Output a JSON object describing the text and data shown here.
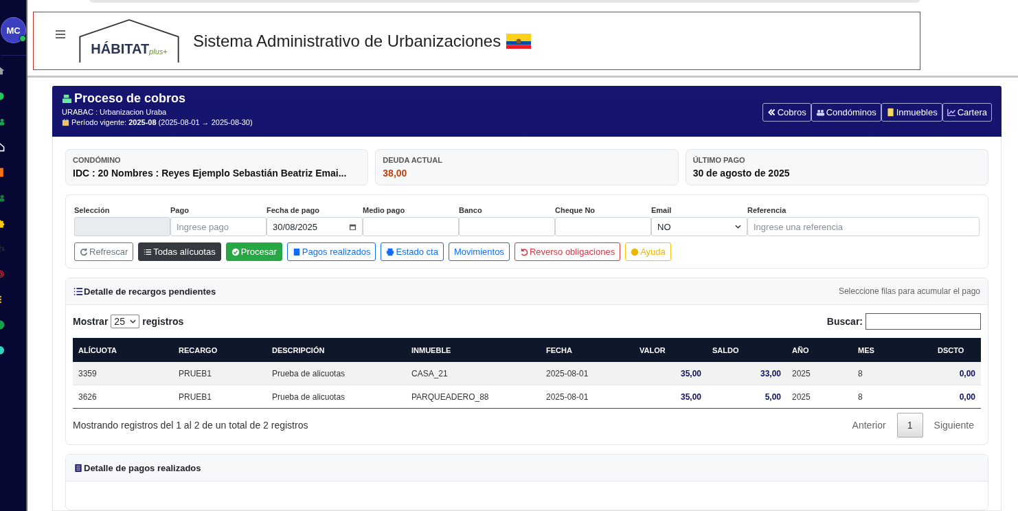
{
  "user": {
    "initials": "MC",
    "online": true
  },
  "header": {
    "logo_text": "HÁBITAT",
    "logo_suffix": "plus+",
    "title": "Sistema Administrativo de Urbanizaciones"
  },
  "panel": {
    "title": "Proceso de cobros",
    "subtitle": "URABAC : Urbanizacion Uraba",
    "period_label": "Período vigente:",
    "period_code": "2025-08",
    "period_range": "(2025-08-01 → 2025-08-30)",
    "nav_buttons": [
      "Cobros",
      "Condóminos",
      "Inmuebles",
      "Cartera"
    ]
  },
  "summary": [
    {
      "label": "CONDÓMINO",
      "value": "IDC : 20 Nombres : Reyes Ejemplo Sebastián Beatriz Emai...",
      "kind": "plain"
    },
    {
      "label": "DEUDA ACTUAL",
      "value": "38,00",
      "kind": "debt"
    },
    {
      "label": "ÚLTIMO PAGO",
      "value": "30 de agosto de 2025",
      "kind": "plain"
    }
  ],
  "form": {
    "fields": [
      {
        "label": "Selección",
        "kind": "readonly"
      },
      {
        "label": "Pago",
        "kind": "text",
        "placeholder": "Ingrese pago"
      },
      {
        "label": "Fecha de pago",
        "kind": "date",
        "value": "30/08/2025"
      },
      {
        "label": "Medio pago",
        "kind": "text"
      },
      {
        "label": "Banco",
        "kind": "text"
      },
      {
        "label": "Cheque No",
        "kind": "text"
      },
      {
        "label": "Email",
        "kind": "select",
        "value": "NO"
      },
      {
        "label": "Referencia",
        "kind": "wide",
        "placeholder": "Ingrese una referencia"
      }
    ],
    "buttons": [
      {
        "label": "Refrescar",
        "kind": "secondary"
      },
      {
        "label": "Todas alícuotas",
        "kind": "dark"
      },
      {
        "label": "Procesar",
        "kind": "success"
      },
      {
        "label": "Pagos realizados",
        "kind": "primary"
      },
      {
        "label": "Estado cta",
        "kind": "primary"
      },
      {
        "label": "Movimientos",
        "kind": "primary"
      },
      {
        "label": "Reverso obligaciones",
        "kind": "danger"
      },
      {
        "label": "Ayuda",
        "kind": "warning"
      }
    ]
  },
  "pending": {
    "title": "Detalle de recargos pendientes",
    "hint": "Seleccione filas para acumular el pago",
    "show_label": "Mostrar",
    "page_size": "25",
    "records_label": "registros",
    "search_label": "Buscar:",
    "table": {
      "columns": [
        "ALÍCUOTA",
        "RECARGO",
        "DESCRIPCIÓN",
        "INMUEBLE",
        "FECHA",
        "VALOR",
        "SALDO",
        "AÑO",
        "MES",
        "DSCTO"
      ],
      "rows": [
        [
          "3359",
          "PRUEB1",
          "Prueba de alicuotas",
          "CASA_21",
          "2025-08-01",
          "35,00",
          "33,00",
          "2025",
          "8",
          "0,00"
        ],
        [
          "3626",
          "PRUEB1",
          "Prueba de alicuotas",
          "PARQUEADERO_88",
          "2025-08-01",
          "35,00",
          "5,00",
          "2025",
          "8",
          "0,00"
        ]
      ]
    },
    "info": "Mostrando registros del 1 al 2 de un total de 2 registros",
    "pagination": {
      "previous": "Anterior",
      "pages": [
        {
          "label": "1",
          "selected": true
        }
      ],
      "next": "Siguiente"
    }
  },
  "payments": {
    "title": "Detalle de pagos realizados"
  }
}
